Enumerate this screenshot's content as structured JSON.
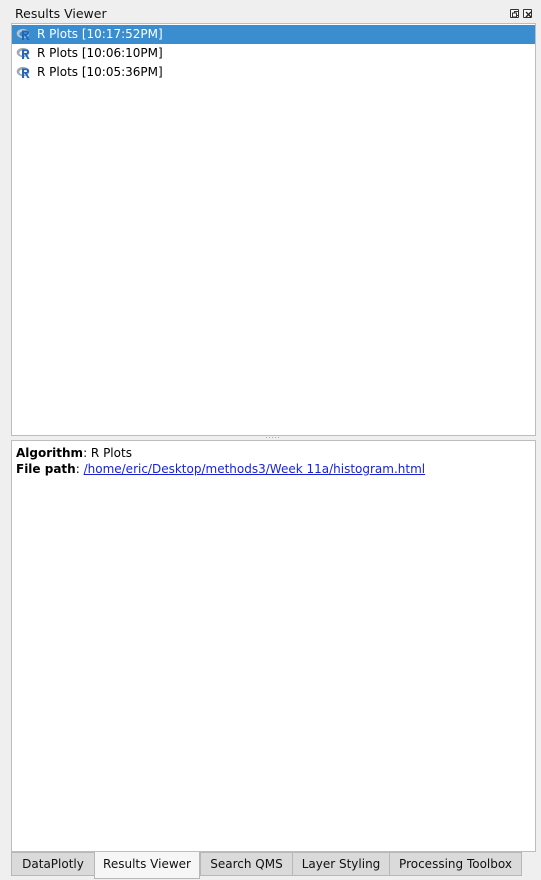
{
  "panel": {
    "title": "Results Viewer"
  },
  "results": [
    {
      "label": "R Plots [10:17:52PM]",
      "selected": true
    },
    {
      "label": "R Plots [10:06:10PM]",
      "selected": false
    },
    {
      "label": "R Plots [10:05:36PM]",
      "selected": false
    }
  ],
  "details": {
    "algorithm_label": "Algorithm",
    "algorithm_value": "R Plots",
    "filepath_label": "File path",
    "filepath_value": "/home/eric/Desktop/methods3/Week 11a/histogram.html"
  },
  "tabs": [
    {
      "label": "DataPlotly",
      "active": false
    },
    {
      "label": "Results Viewer",
      "active": true
    },
    {
      "label": "Search QMS",
      "active": false
    },
    {
      "label": "Layer Styling",
      "active": false
    },
    {
      "label": "Processing Toolbox",
      "active": false
    }
  ],
  "colors": {
    "selection": "#3a8ed0",
    "link": "#1a22d8",
    "r_icon": "#2266b8"
  },
  "icons": {
    "result_item": "r-logo-icon",
    "float": "float-window-icon",
    "close": "close-icon"
  }
}
